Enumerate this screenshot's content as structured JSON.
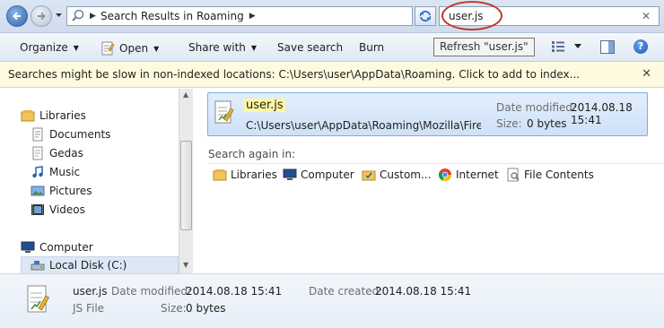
{
  "address": {
    "location": "Search Results in Roaming"
  },
  "search": {
    "query": "user.js"
  },
  "tooltip": "Refresh \"user.js\"",
  "toolbar": {
    "organize": "Organize",
    "open": "Open",
    "share_with": "Share with",
    "save_search": "Save search",
    "burn": "Burn"
  },
  "infobar": {
    "message": "Searches might be slow in non-indexed locations: C:\\Users\\user\\AppData\\Roaming. Click to add to index..."
  },
  "nav": {
    "libraries": "Libraries",
    "items": [
      "Documents",
      "Gedas",
      "Music",
      "Pictures",
      "Videos"
    ],
    "computer": "Computer",
    "local_disk": "Local Disk (C:)"
  },
  "result": {
    "name": "user.js",
    "path": "C:\\Users\\user\\AppData\\Roaming\\Mozilla\\Firefo...",
    "date_label": "Date modified:",
    "date": "2014.08.18 15:41",
    "size_label": "Size:",
    "size": "0 bytes"
  },
  "search_again": {
    "heading": "Search again in:",
    "options": [
      "Libraries",
      "Computer",
      "Custom...",
      "Internet",
      "File Contents"
    ]
  },
  "details": {
    "name": "user.js",
    "type": "JS File",
    "date_modified_label": "Date modified:",
    "date_modified": "2014.08.18 15:41",
    "size_label": "Size:",
    "size": "0 bytes",
    "date_created_label": "Date created:",
    "date_created": "2014.08.18 15:41"
  },
  "colors": {
    "highlight_circle": "#c0392b",
    "selection": "#cfe1f8",
    "infobar": "#fefadf"
  }
}
